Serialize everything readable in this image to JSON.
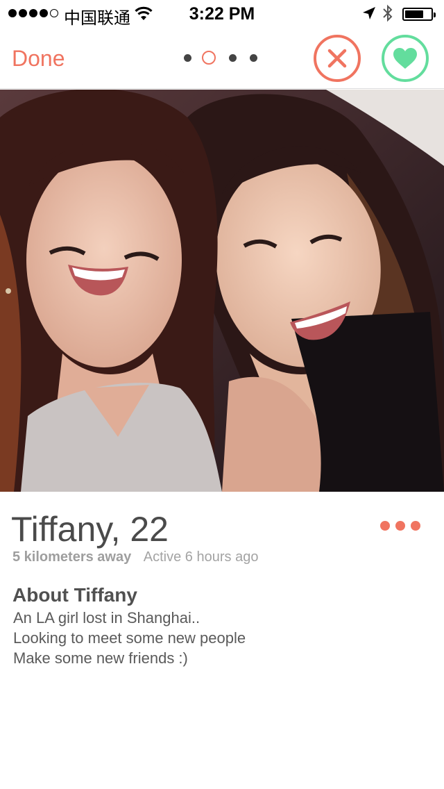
{
  "status_bar": {
    "carrier": "中国联通",
    "time": "3:22 PM",
    "signal_strength": 4,
    "signal_max": 5,
    "battery_fraction": 0.72,
    "icons": [
      "wifi-icon",
      "location-arrow-icon",
      "bluetooth-icon",
      "battery-icon"
    ]
  },
  "nav": {
    "done_label": "Done",
    "page_count": 4,
    "active_page": 2,
    "nope_icon": "close-x-icon",
    "like_icon": "heart-icon"
  },
  "colors": {
    "accent": "#f07460",
    "like": "#63dd9d",
    "text": "#4a4a4a",
    "muted": "#a3a3a3"
  },
  "profile": {
    "name_age": "Tiffany, 22",
    "distance": "5 kilometers away",
    "last_active": "Active 6 hours ago",
    "about_title": "About Tiffany",
    "bio_lines": [
      "An LA girl lost in Shanghai..",
      "Looking to meet some new people",
      "Make some new friends :)"
    ]
  }
}
